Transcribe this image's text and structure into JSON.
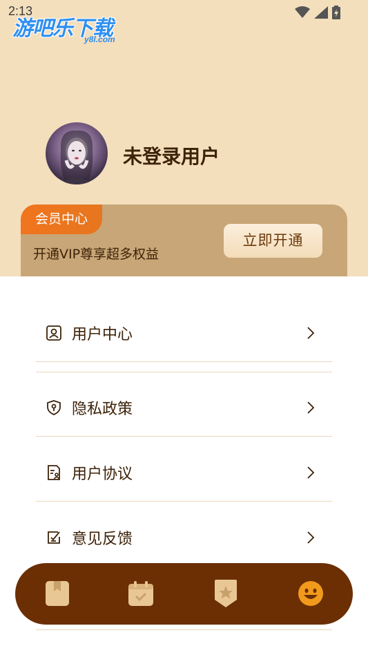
{
  "status_bar": {
    "time": "2:13"
  },
  "watermark": {
    "main": "游吧乐下载",
    "sub": "y8l.com"
  },
  "profile": {
    "user_name": "未登录用户",
    "avatar_icon": "avatar-image"
  },
  "vip": {
    "tag_label": "会员中心",
    "description": "开通VIP尊享超多权益",
    "button_label": "立即开通"
  },
  "menu": {
    "items": [
      {
        "label": "用户中心",
        "icon": "user-card-icon"
      },
      {
        "label": "隐私政策",
        "icon": "privacy-shield-icon"
      },
      {
        "label": "用户协议",
        "icon": "agreement-doc-icon"
      },
      {
        "label": "意见反馈",
        "icon": "feedback-edit-icon"
      }
    ]
  },
  "tabbar": {
    "tabs": [
      {
        "icon": "bookmark-icon",
        "active": false
      },
      {
        "icon": "calendar-check-icon",
        "active": false
      },
      {
        "icon": "star-badge-icon",
        "active": false
      },
      {
        "icon": "smiley-icon",
        "active": true
      }
    ]
  },
  "colors": {
    "header_bg": "#f4dfbd",
    "vip_card": "#c8a677",
    "vip_tag": "#f0751e",
    "tabbar_bg": "#6b2f03",
    "active_tab": "#f29a1c",
    "inactive_tab": "#e8c795",
    "text_primary": "#3c2208"
  }
}
